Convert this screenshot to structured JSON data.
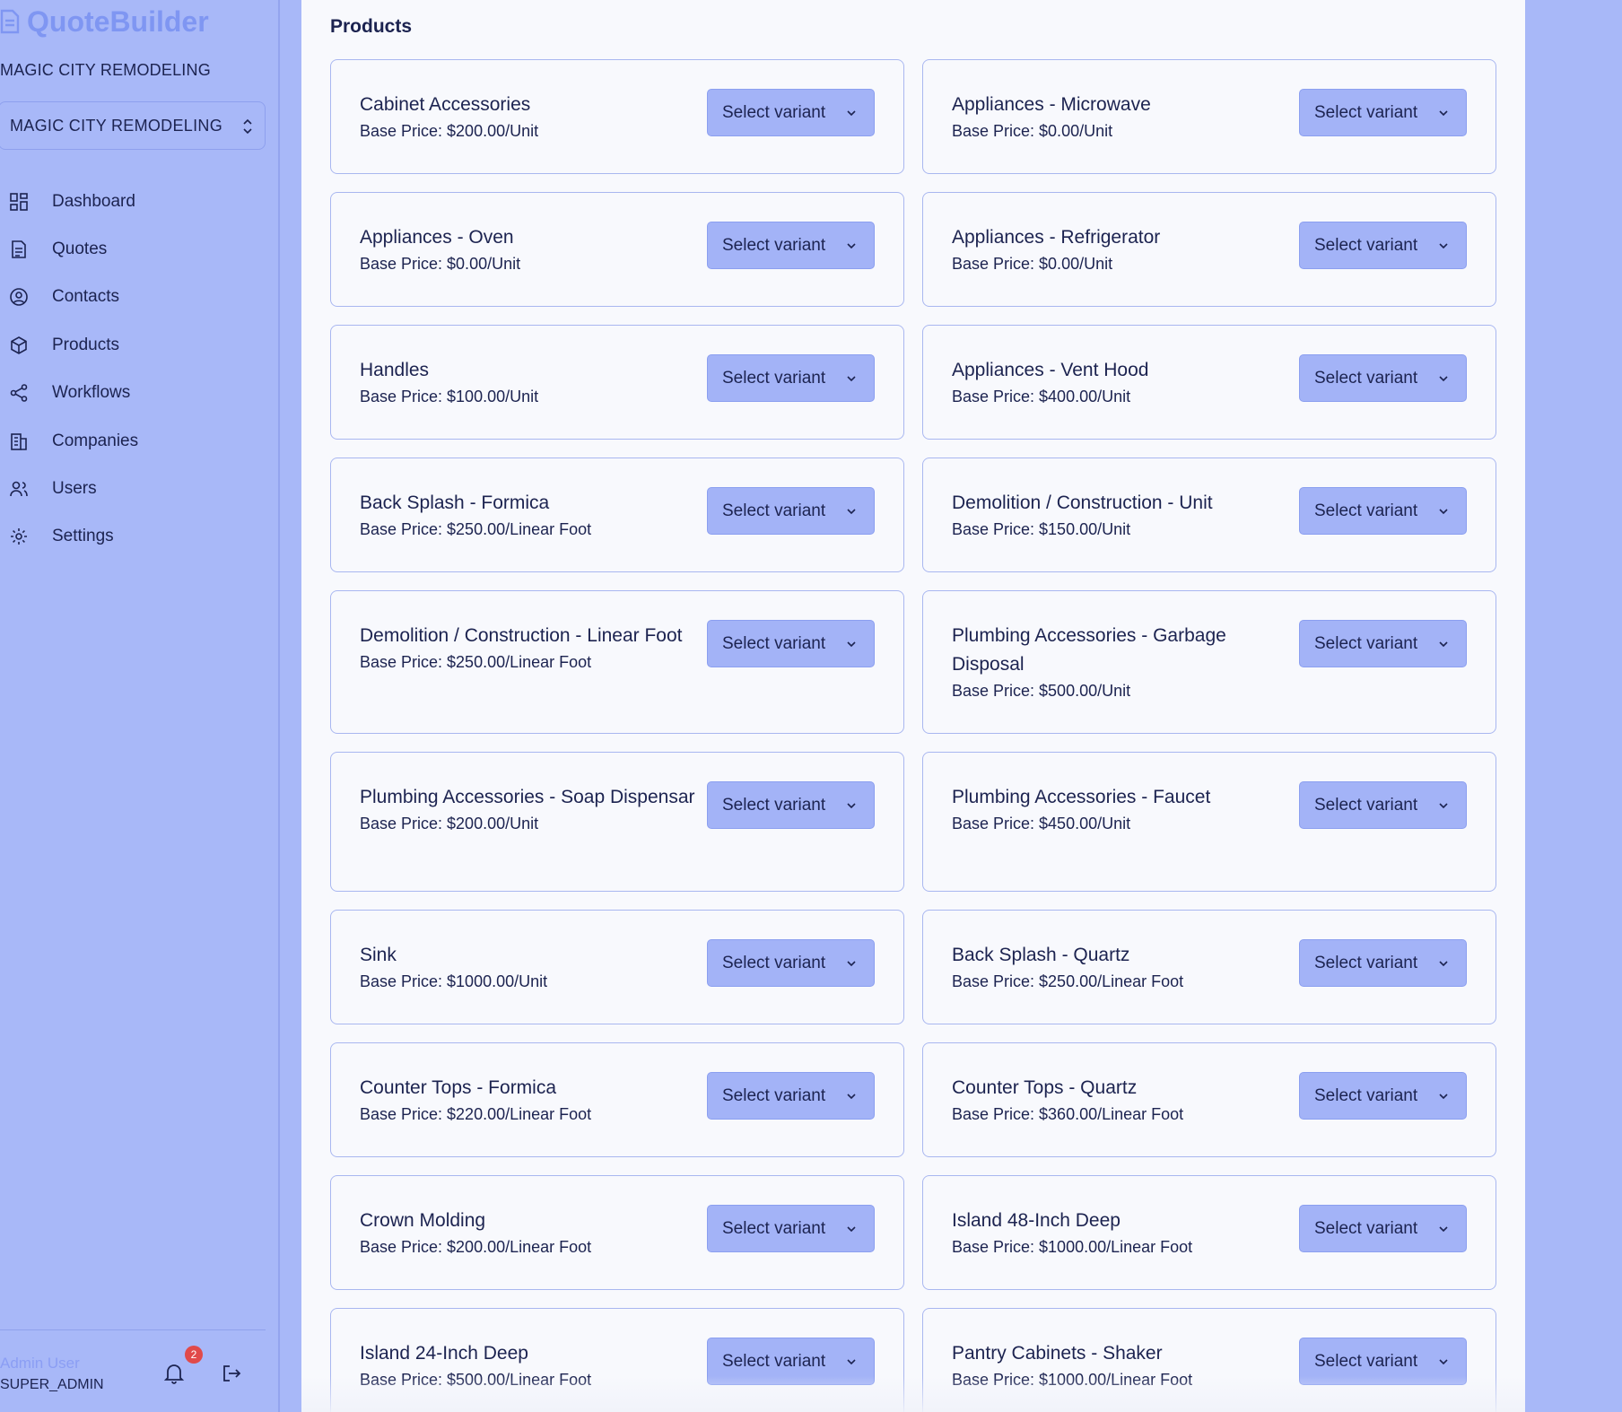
{
  "app": {
    "title": "QuoteBuilder",
    "org_name": "MAGIC CITY REMODELING",
    "org_select_value": "MAGIC CITY REMODELING"
  },
  "nav": [
    {
      "label": "Dashboard",
      "icon": "dashboard-icon"
    },
    {
      "label": "Quotes",
      "icon": "document-icon"
    },
    {
      "label": "Contacts",
      "icon": "user-circle-icon"
    },
    {
      "label": "Products",
      "icon": "package-icon"
    },
    {
      "label": "Workflows",
      "icon": "share-icon"
    },
    {
      "label": "Companies",
      "icon": "building-icon"
    },
    {
      "label": "Users",
      "icon": "users-icon"
    },
    {
      "label": "Settings",
      "icon": "gear-icon"
    }
  ],
  "user": {
    "name": "Admin User",
    "role": "SUPER_ADMIN",
    "notification_count": "2"
  },
  "page": {
    "title": "Products"
  },
  "select_label": "Select variant",
  "products": [
    {
      "name": "Cabinet Accessories",
      "price": "Base Price: $200.00/Unit"
    },
    {
      "name": "Appliances - Microwave",
      "price": "Base Price: $0.00/Unit"
    },
    {
      "name": "Appliances - Oven",
      "price": "Base Price: $0.00/Unit"
    },
    {
      "name": "Appliances - Refrigerator",
      "price": "Base Price: $0.00/Unit"
    },
    {
      "name": "Handles",
      "price": "Base Price: $100.00/Unit"
    },
    {
      "name": "Appliances - Vent Hood",
      "price": "Base Price: $400.00/Unit"
    },
    {
      "name": "Back Splash - Formica",
      "price": "Base Price: $250.00/Linear Foot"
    },
    {
      "name": "Demolition / Construction - Unit",
      "price": "Base Price: $150.00/Unit"
    },
    {
      "name": "Demolition / Construction - Linear Foot",
      "price": "Base Price: $250.00/Linear Foot"
    },
    {
      "name": "Plumbing Accessories - Garbage Disposal",
      "price": "Base Price: $500.00/Unit"
    },
    {
      "name": "Plumbing Accessories - Soap Dispensar",
      "price": "Base Price: $200.00/Unit"
    },
    {
      "name": "Plumbing Accessories - Faucet",
      "price": "Base Price: $450.00/Unit"
    },
    {
      "name": "Sink",
      "price": "Base Price: $1000.00/Unit"
    },
    {
      "name": "Back Splash - Quartz",
      "price": "Base Price: $250.00/Linear Foot"
    },
    {
      "name": "Counter Tops - Formica",
      "price": "Base Price: $220.00/Linear Foot"
    },
    {
      "name": "Counter Tops - Quartz",
      "price": "Base Price: $360.00/Linear Foot"
    },
    {
      "name": "Crown Molding",
      "price": "Base Price: $200.00/Linear Foot"
    },
    {
      "name": "Island 48-Inch Deep",
      "price": "Base Price: $1000.00/Linear Foot"
    },
    {
      "name": "Island 24-Inch Deep",
      "price": "Base Price: $500.00/Linear Foot"
    },
    {
      "name": "Pantry Cabinets - Shaker",
      "price": "Base Price: $1000.00/Linear Foot"
    }
  ]
}
